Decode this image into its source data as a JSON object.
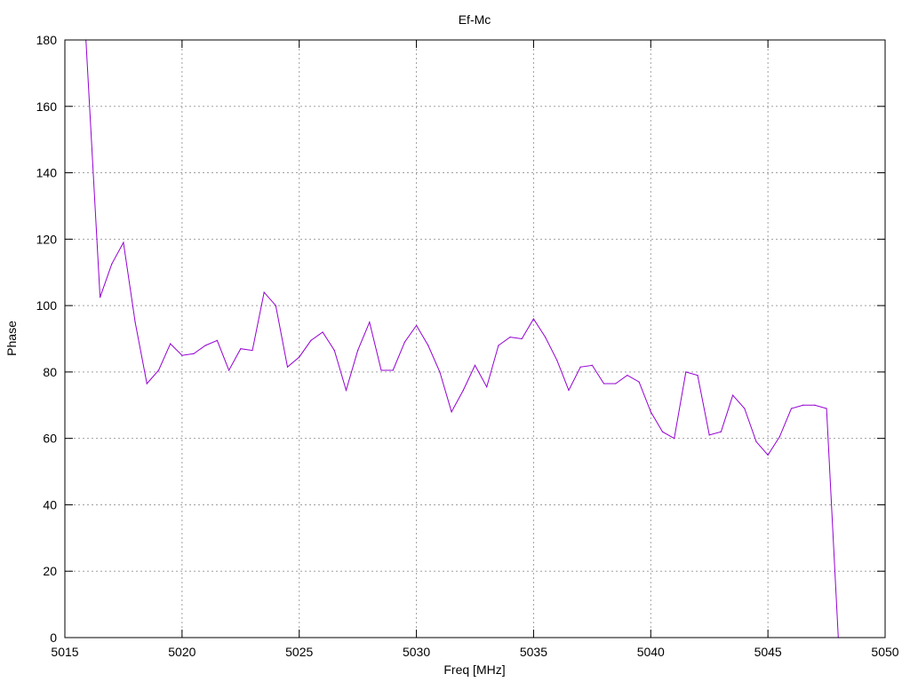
{
  "chart_data": {
    "type": "line",
    "title": "Ef-Mc",
    "xlabel": "Freq [MHz]",
    "ylabel": "Phase",
    "xlim": [
      5015,
      5050
    ],
    "ylim": [
      0,
      180
    ],
    "xticks": [
      5015,
      5020,
      5025,
      5030,
      5035,
      5040,
      5045,
      5050
    ],
    "yticks": [
      0,
      20,
      40,
      60,
      80,
      100,
      120,
      140,
      160,
      180
    ],
    "grid": true,
    "legend": "none",
    "colors": {
      "series": "#9400d3",
      "grid": "#a0a0a0",
      "frame": "#000000"
    },
    "series": [
      {
        "x": [
          5015.9,
          5016.5,
          5017.0,
          5017.5,
          5018.0,
          5018.5,
          5019.0,
          5019.5,
          5020.0,
          5020.5,
          5021.0,
          5021.5,
          5022.0,
          5022.5,
          5023.0,
          5023.5,
          5024.0,
          5024.5,
          5025.0,
          5025.5,
          5026.0,
          5026.5,
          5027.0,
          5027.5,
          5028.0,
          5028.5,
          5029.0,
          5029.5,
          5030.0,
          5030.5,
          5031.0,
          5031.5,
          5032.0,
          5032.5,
          5033.0,
          5033.5,
          5034.0,
          5034.5,
          5035.0,
          5035.5,
          5036.0,
          5036.5,
          5037.0,
          5037.5,
          5038.0,
          5038.5,
          5039.0,
          5039.5,
          5040.0,
          5040.5,
          5041.0,
          5041.5,
          5042.0,
          5042.5,
          5043.0,
          5043.5,
          5044.0,
          5044.5,
          5045.0,
          5045.5,
          5046.0,
          5046.5,
          5047.0,
          5047.5,
          5048.0
        ],
        "y": [
          180,
          102.5,
          112.5,
          119,
          95,
          76.5,
          80.5,
          88.5,
          85,
          85.5,
          88,
          89.5,
          80.5,
          87,
          86.5,
          104,
          100,
          81.5,
          84.5,
          89.5,
          92,
          86.5,
          74.5,
          86.5,
          95,
          80.5,
          80.5,
          89,
          94,
          88,
          80,
          68,
          74.5,
          82,
          75.5,
          88,
          90.5,
          90,
          96,
          90.5,
          83.5,
          74.5,
          81.5,
          82,
          76.5,
          76.5,
          79,
          77,
          68,
          62,
          60,
          80,
          79,
          61,
          62,
          73,
          69,
          59,
          55,
          60.5,
          69,
          70,
          70,
          69,
          0
        ]
      }
    ]
  }
}
